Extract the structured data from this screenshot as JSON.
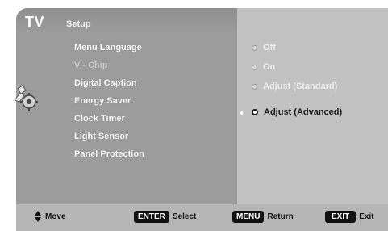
{
  "header": {
    "mode": "TV",
    "title": "Setup"
  },
  "menu": {
    "items": [
      {
        "label": "Menu Language",
        "enabled": true
      },
      {
        "label": "V - Chip",
        "enabled": false
      },
      {
        "label": "Digital Caption",
        "enabled": true
      },
      {
        "label": "Energy Saver",
        "enabled": true
      },
      {
        "label": "Clock Timer",
        "enabled": true
      },
      {
        "label": "Light Sensor",
        "enabled": true
      },
      {
        "label": "Panel Protection",
        "enabled": true
      }
    ],
    "icon": "setup-gear-icon"
  },
  "options": {
    "items": [
      {
        "label": "Off",
        "selected": false
      },
      {
        "label": "On",
        "selected": false
      },
      {
        "label": "Adjust (Standard)",
        "selected": false
      },
      {
        "label": "Adjust (Advanced)",
        "selected": true
      }
    ]
  },
  "footer": {
    "move": {
      "icon": "up-down-arrows-icon",
      "label": "Move"
    },
    "select": {
      "key": "ENTER",
      "label": "Select"
    },
    "return": {
      "key": "MENU",
      "label": "Return"
    },
    "exit": {
      "key": "EXIT",
      "label": "Exit"
    }
  },
  "colors": {
    "panel": "#9c9c9c",
    "options_panel": "#c2c2c2",
    "footer": "#b6b6b6",
    "key_bg": "#111111"
  }
}
